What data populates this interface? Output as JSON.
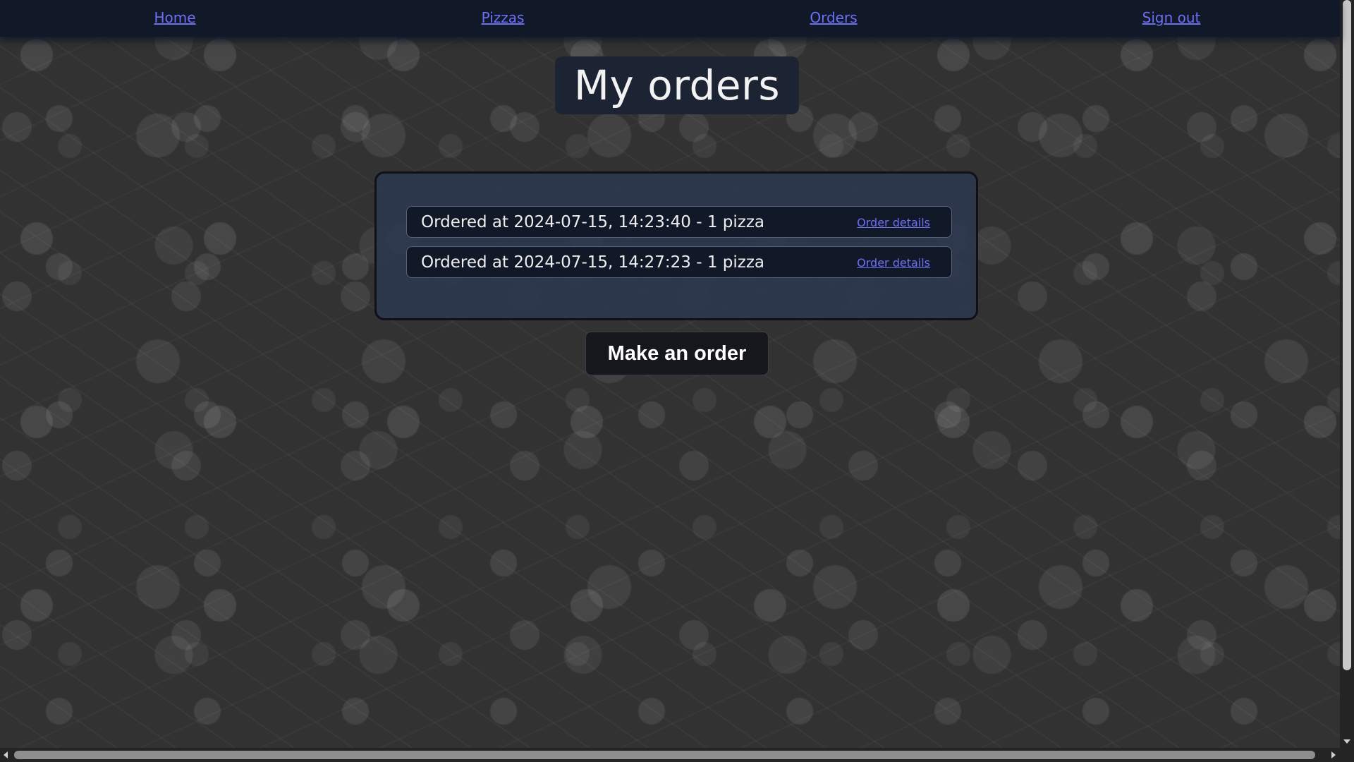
{
  "nav": {
    "home": "Home",
    "pizzas": "Pizzas",
    "orders": "Orders",
    "sign_out": "Sign out"
  },
  "page_title": "My orders",
  "orders": [
    {
      "text": "Ordered at 2024-07-15, 14:23:40 - 1 pizza",
      "link": "Order details"
    },
    {
      "text": "Ordered at 2024-07-15, 14:27:23 - 1 pizza",
      "link": "Order details"
    }
  ],
  "make_order_label": "Make an order",
  "colors": {
    "link": "#6d6ff5",
    "navbar": "#111827",
    "panel": "#2c384e",
    "background": "#323232"
  }
}
